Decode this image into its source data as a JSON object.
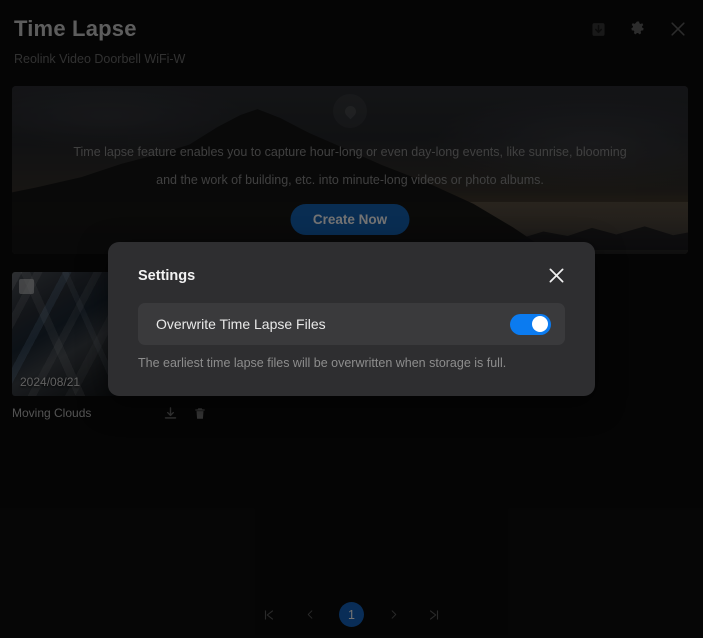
{
  "header": {
    "title": "Time Lapse",
    "subtitle": "Reolink Video Doorbell WiFi-W",
    "icons": {
      "download": "download-box-icon",
      "settings": "gear-icon",
      "close": "close-icon"
    }
  },
  "banner": {
    "description": "Time lapse feature enables you to capture hour-long or even day-long events, like sunrise, blooming and the work of building, etc. into minute-long videos or photo albums.",
    "create_label": "Create Now",
    "watermark": "reolink-logo-watermark"
  },
  "items": [
    {
      "name": "Moving Clouds",
      "date": "2024/08/21",
      "download_icon": "download-icon",
      "delete_icon": "trash-icon"
    }
  ],
  "pagination": {
    "first": "|<",
    "prev": "‹",
    "current": "1",
    "next": "›",
    "last": ">|"
  },
  "modal": {
    "title": "Settings",
    "close": "close-icon",
    "setting_label": "Overwrite Time Lapse Files",
    "toggle_state": "on",
    "hint": "The earliest time lapse files will be overwritten when storage is full."
  },
  "colors": {
    "accent_blue": "#0b7bf0",
    "page_badge_blue": "#1565c0",
    "create_button_blue": "#1664b6",
    "modal_bg": "#2e2e30",
    "row_bg": "#3a3a3c",
    "page_bg": "#0d0d0d"
  }
}
